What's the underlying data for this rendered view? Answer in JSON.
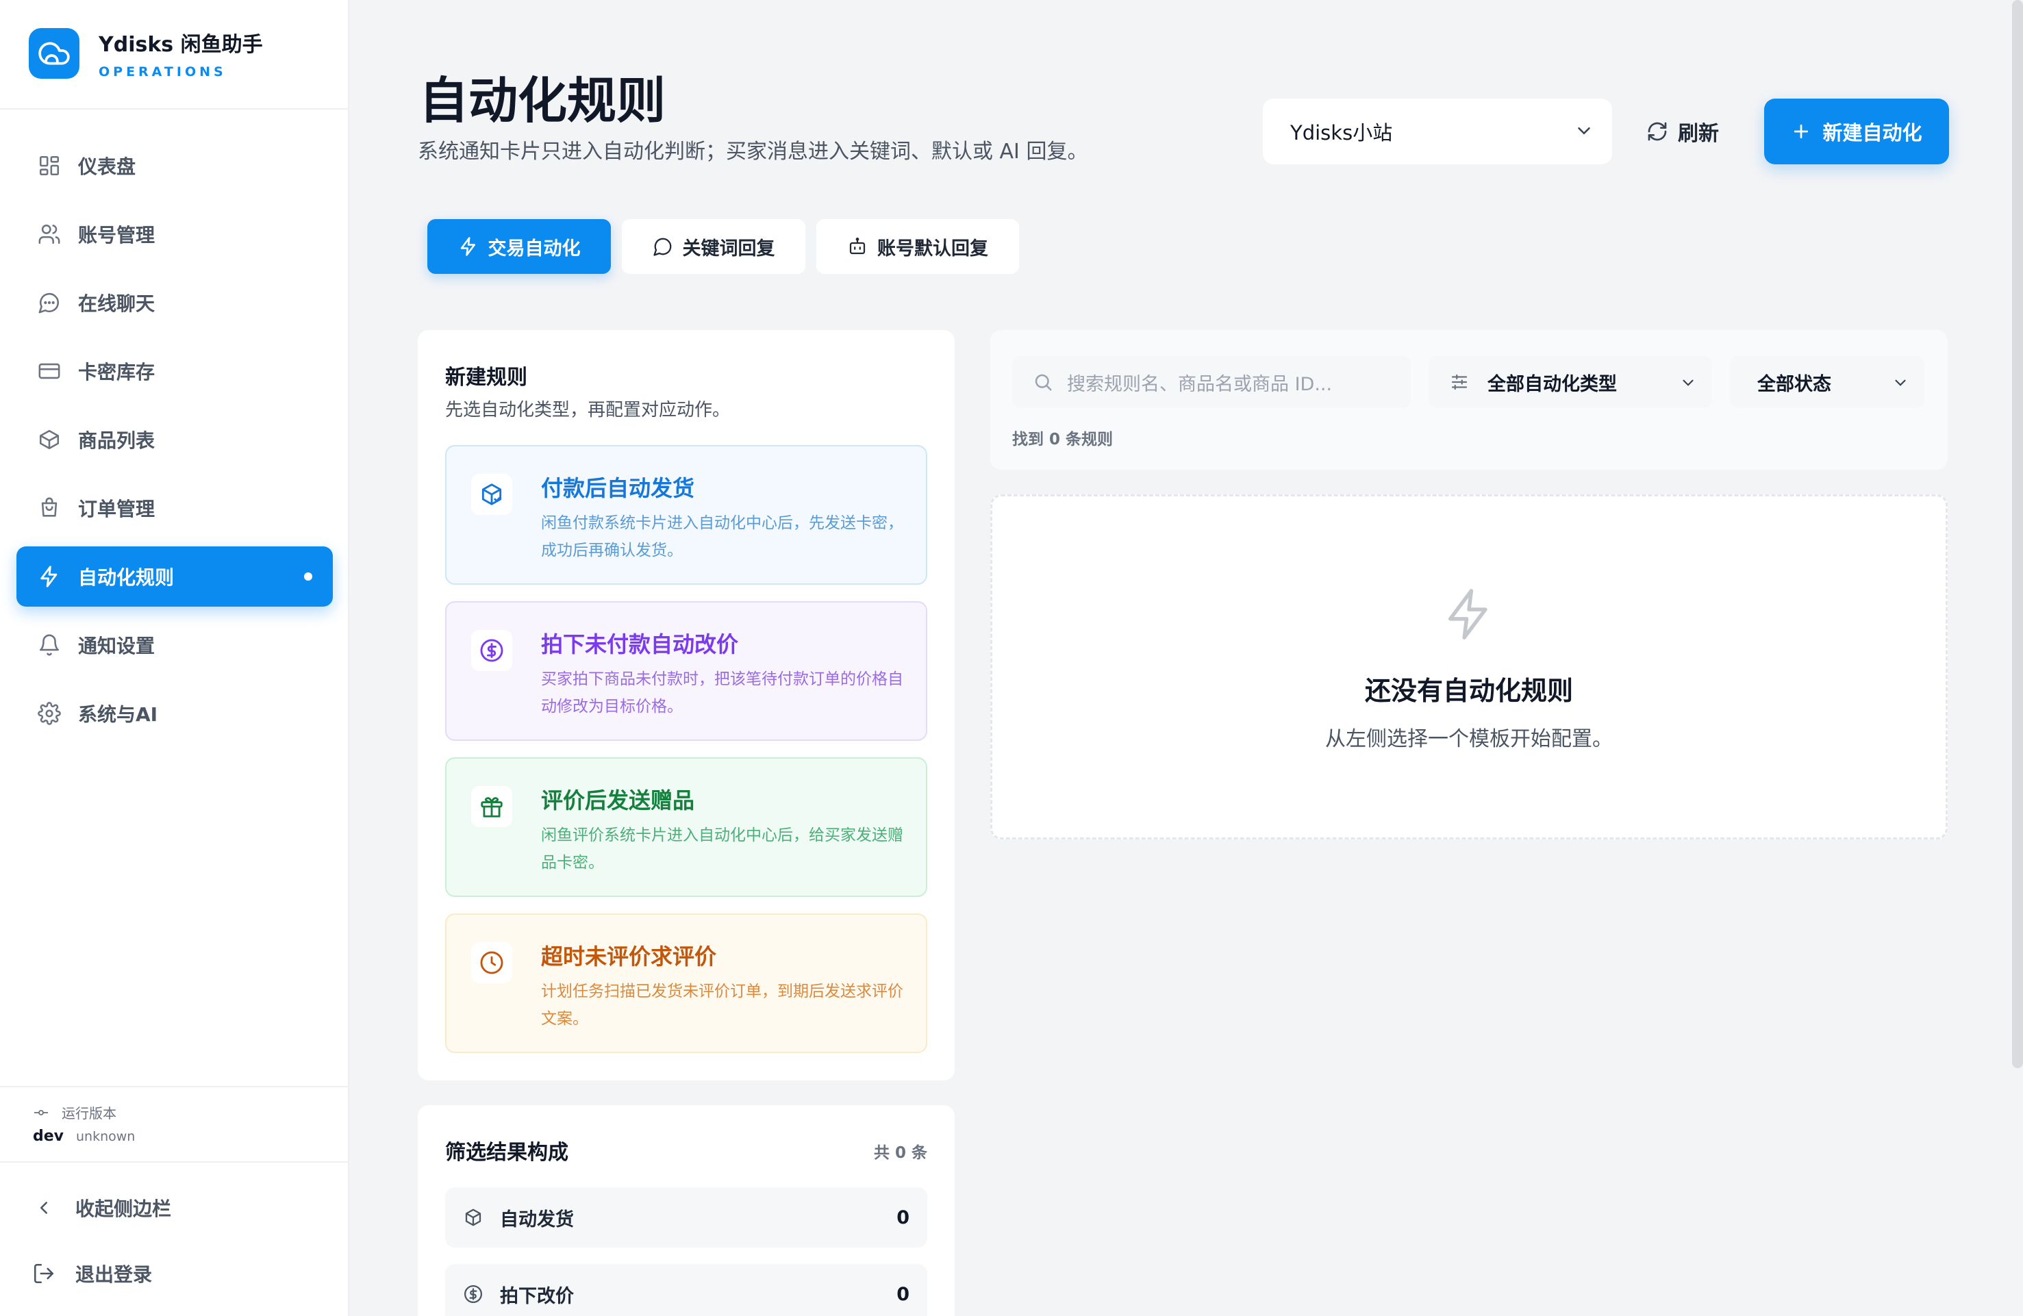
{
  "brand": {
    "name": "Ydisks 闲鱼助手",
    "sub": "OPERATIONS"
  },
  "nav": [
    {
      "label": "仪表盘",
      "icon": "dashboard-icon"
    },
    {
      "label": "账号管理",
      "icon": "users-icon"
    },
    {
      "label": "在线聊天",
      "icon": "chat-icon"
    },
    {
      "label": "卡密库存",
      "icon": "card-icon"
    },
    {
      "label": "商品列表",
      "icon": "box-icon"
    },
    {
      "label": "订单管理",
      "icon": "bag-icon"
    },
    {
      "label": "自动化规则",
      "icon": "bolt-icon",
      "active": true
    },
    {
      "label": "通知设置",
      "icon": "bell-icon"
    },
    {
      "label": "系统与AI",
      "icon": "gear-icon"
    }
  ],
  "version": {
    "label": "运行版本",
    "value": "dev",
    "detail": "unknown"
  },
  "sidebar_bottom": {
    "collapse": "收起侧边栏",
    "logout": "退出登录"
  },
  "header": {
    "title": "自动化规则",
    "subtitle": "系统通知卡片只进入自动化判断；买家消息进入关键词、默认或 AI 回复。",
    "account": "Ydisks小站",
    "refresh": "刷新",
    "new": "新建自动化"
  },
  "tabs": [
    {
      "label": "交易自动化",
      "active": true
    },
    {
      "label": "关键词回复"
    },
    {
      "label": "账号默认回复"
    }
  ],
  "new_rule": {
    "title": "新建规则",
    "desc": "先选自动化类型，再配置对应动作。",
    "templates": [
      {
        "title": "付款后自动发货",
        "desc": "闲鱼付款系统卡片进入自动化中心后，先发送卡密，成功后再确认发货。",
        "icon": "package-icon",
        "color": "#1677d9"
      },
      {
        "title": "拍下未付款自动改价",
        "desc": "买家拍下商品未付款时，把该笔待付款订单的价格自动修改为目标价格。",
        "icon": "dollar-icon",
        "color": "#7c3aed"
      },
      {
        "title": "评价后发送赠品",
        "desc": "闲鱼评价系统卡片进入自动化中心后，给买家发送赠品卡密。",
        "icon": "gift-icon",
        "color": "#15803d"
      },
      {
        "title": "超时未评价求评价",
        "desc": "计划任务扫描已发货未评价订单，到期后发送求评价文案。",
        "icon": "clock-icon",
        "color": "#c2570c"
      }
    ]
  },
  "composition": {
    "title": "筛选结果构成",
    "total": "共 0 条",
    "rows": [
      {
        "label": "自动发货",
        "count": "0"
      },
      {
        "label": "拍下改价",
        "count": "0"
      }
    ]
  },
  "filters": {
    "search_placeholder": "搜索规则名、商品名或商品 ID...",
    "type": "全部自动化类型",
    "status": "全部状态",
    "found": "找到 0 条规则"
  },
  "empty": {
    "title": "还没有自动化规则",
    "desc": "从左侧选择一个模板开始配置。"
  }
}
